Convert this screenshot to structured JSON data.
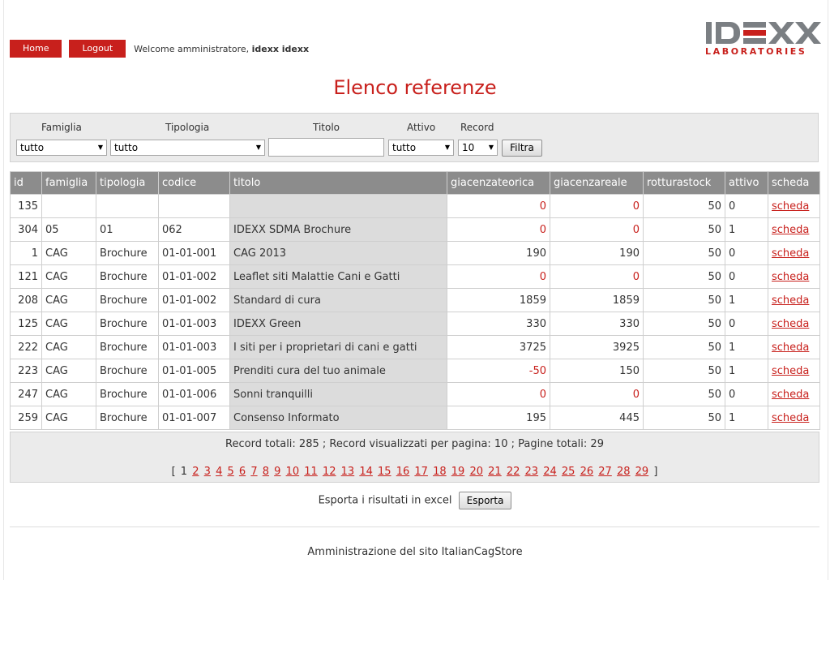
{
  "nav": {
    "home": "Home",
    "logout": "Logout",
    "welcome_prefix": "Welcome amministratore, ",
    "user": "idexx idexx"
  },
  "logo": {
    "word": "IDEXX",
    "sub": "LABORATORIES"
  },
  "page_title": "Elenco referenze",
  "filter": {
    "labels": {
      "famiglia": "Famiglia",
      "tipologia": "Tipologia",
      "titolo": "Titolo",
      "attivo": "Attivo",
      "record": "Record"
    },
    "values": {
      "famiglia": "tutto",
      "tipologia": "tutto",
      "titolo": "",
      "attivo": "tutto",
      "record": "10"
    },
    "button": "Filtra"
  },
  "table": {
    "headers": [
      "id",
      "famiglia",
      "tipologia",
      "codice",
      "titolo",
      "giacenzateorica",
      "giacenzareale",
      "rotturastock",
      "attivo",
      "scheda"
    ],
    "rows": [
      {
        "id": "135",
        "famiglia": "",
        "tipologia": "",
        "codice": "",
        "titolo": "",
        "teorica": "0",
        "reale": "0",
        "rottura": "50",
        "attivo": "0",
        "scheda": "scheda",
        "teorica_neg": true,
        "reale_neg": true
      },
      {
        "id": "304",
        "famiglia": "05",
        "tipologia": "01",
        "codice": "062",
        "titolo": "IDEXX SDMA Brochure",
        "teorica": "0",
        "reale": "0",
        "rottura": "50",
        "attivo": "1",
        "scheda": "scheda",
        "teorica_neg": true,
        "reale_neg": true
      },
      {
        "id": "1",
        "famiglia": "CAG",
        "tipologia": "Brochure",
        "codice": "01-01-001",
        "titolo": "CAG 2013",
        "teorica": "190",
        "reale": "190",
        "rottura": "50",
        "attivo": "0",
        "scheda": "scheda",
        "teorica_neg": false,
        "reale_neg": false
      },
      {
        "id": "121",
        "famiglia": "CAG",
        "tipologia": "Brochure",
        "codice": "01-01-002",
        "titolo": "Leaflet siti Malattie Cani e Gatti",
        "teorica": "0",
        "reale": "0",
        "rottura": "50",
        "attivo": "0",
        "scheda": "scheda",
        "teorica_neg": true,
        "reale_neg": true
      },
      {
        "id": "208",
        "famiglia": "CAG",
        "tipologia": "Brochure",
        "codice": "01-01-002",
        "titolo": "Standard di cura",
        "teorica": "1859",
        "reale": "1859",
        "rottura": "50",
        "attivo": "1",
        "scheda": "scheda",
        "teorica_neg": false,
        "reale_neg": false
      },
      {
        "id": "125",
        "famiglia": "CAG",
        "tipologia": "Brochure",
        "codice": "01-01-003",
        "titolo": "IDEXX Green",
        "teorica": "330",
        "reale": "330",
        "rottura": "50",
        "attivo": "0",
        "scheda": "scheda",
        "teorica_neg": false,
        "reale_neg": false
      },
      {
        "id": "222",
        "famiglia": "CAG",
        "tipologia": "Brochure",
        "codice": "01-01-003",
        "titolo": "I siti per i proprietari di cani e gatti",
        "teorica": "3725",
        "reale": "3925",
        "rottura": "50",
        "attivo": "1",
        "scheda": "scheda",
        "teorica_neg": false,
        "reale_neg": false
      },
      {
        "id": "223",
        "famiglia": "CAG",
        "tipologia": "Brochure",
        "codice": "01-01-005",
        "titolo": "Prenditi cura del tuo animale",
        "teorica": "-50",
        "reale": "150",
        "rottura": "50",
        "attivo": "1",
        "scheda": "scheda",
        "teorica_neg": true,
        "reale_neg": false
      },
      {
        "id": "247",
        "famiglia": "CAG",
        "tipologia": "Brochure",
        "codice": "01-01-006",
        "titolo": "Sonni tranquilli",
        "teorica": "0",
        "reale": "0",
        "rottura": "50",
        "attivo": "0",
        "scheda": "scheda",
        "teorica_neg": true,
        "reale_neg": true
      },
      {
        "id": "259",
        "famiglia": "CAG",
        "tipologia": "Brochure",
        "codice": "01-01-007",
        "titolo": "Consenso Informato",
        "teorica": "195",
        "reale": "445",
        "rottura": "50",
        "attivo": "1",
        "scheda": "scheda",
        "teorica_neg": false,
        "reale_neg": false
      }
    ]
  },
  "summary": {
    "text": "Record totali: 285 ; Record visualizzati per pagina: 10 ; Pagine totali: 29",
    "bracket_open": "[",
    "bracket_close": "]",
    "current_page": "1",
    "pages": [
      "2",
      "3",
      "4",
      "5",
      "6",
      "7",
      "8",
      "9",
      "10",
      "11",
      "12",
      "13",
      "14",
      "15",
      "16",
      "17",
      "18",
      "19",
      "20",
      "21",
      "22",
      "23",
      "24",
      "25",
      "26",
      "27",
      "28",
      "29"
    ]
  },
  "export": {
    "label": "Esporta i risultati in excel",
    "button": "Esporta"
  },
  "footer": "Amministrazione del sito ItalianCagStore",
  "colors": {
    "accent": "#c8201c",
    "header_bg": "#8c8c8c",
    "logo_grey": "#7b7f83"
  }
}
